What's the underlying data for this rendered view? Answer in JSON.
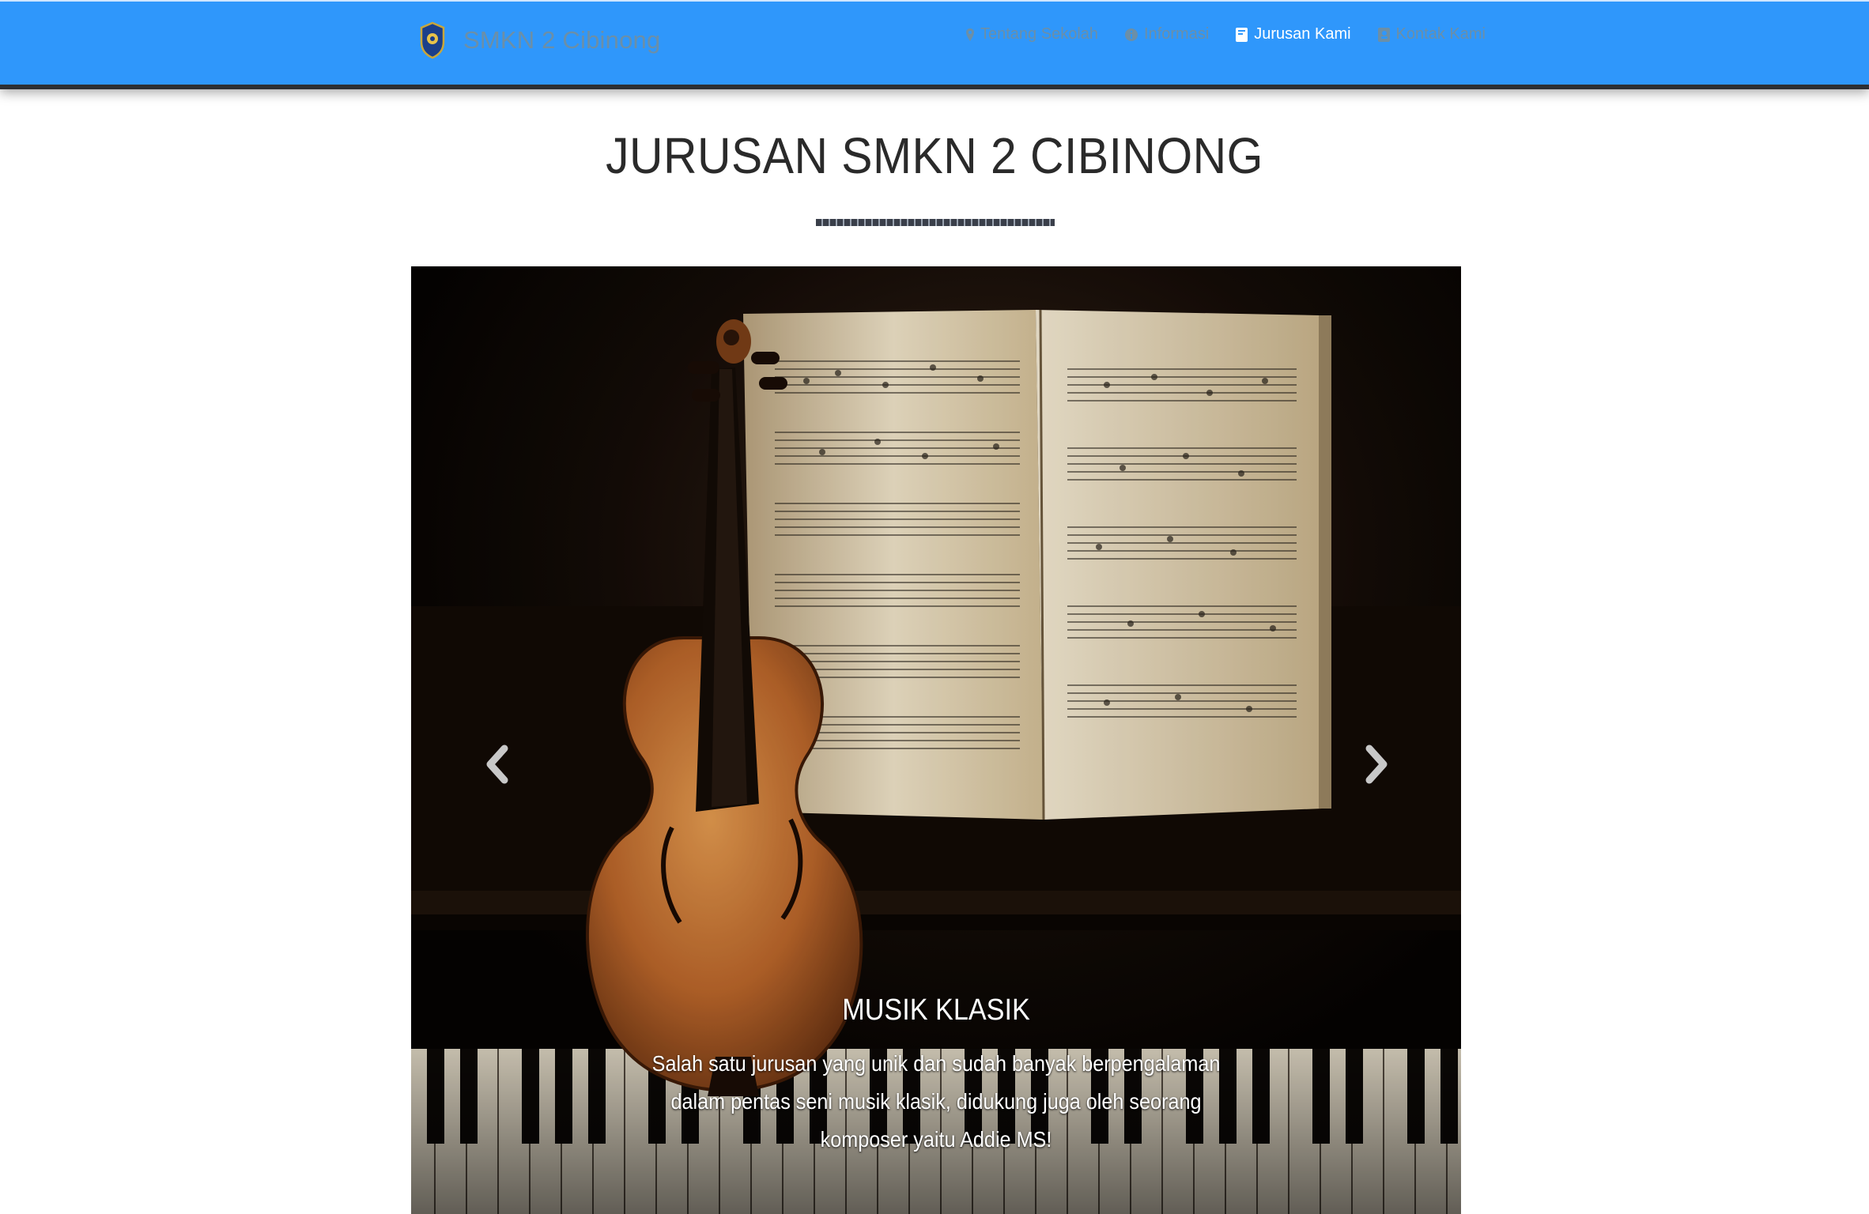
{
  "navbar": {
    "brand_name": "SMKN 2 Cibinong",
    "brand_logo_icon": "school-crest-icon",
    "items": [
      {
        "label": "Tentang Sekolah",
        "icon": "map-marker-icon",
        "active": false
      },
      {
        "label": "Informasi",
        "icon": "info-circle-icon",
        "active": false
      },
      {
        "label": "Jurusan Kami",
        "icon": "book-icon",
        "active": true
      },
      {
        "label": "Kontak Kami",
        "icon": "phone-book-icon",
        "active": false
      }
    ],
    "colors": {
      "background": "#2f97fb",
      "link": "#6b8fa8",
      "active_link": "#ffffff"
    }
  },
  "page": {
    "title": "JURUSAN SMKN 2 CIBINONG"
  },
  "carousel": {
    "slides": [
      {
        "image": "violin-on-piano-with-sheet-music",
        "title": "MUSIK KLASIK",
        "text": "Salah satu jurusan yang unik dan sudah banyak berpengalaman dalam pentas seni musik klasik, didukung juga oleh seorang komposer yaitu Addie MS!"
      }
    ],
    "prev_icon": "chevron-left-icon",
    "next_icon": "chevron-right-icon"
  }
}
